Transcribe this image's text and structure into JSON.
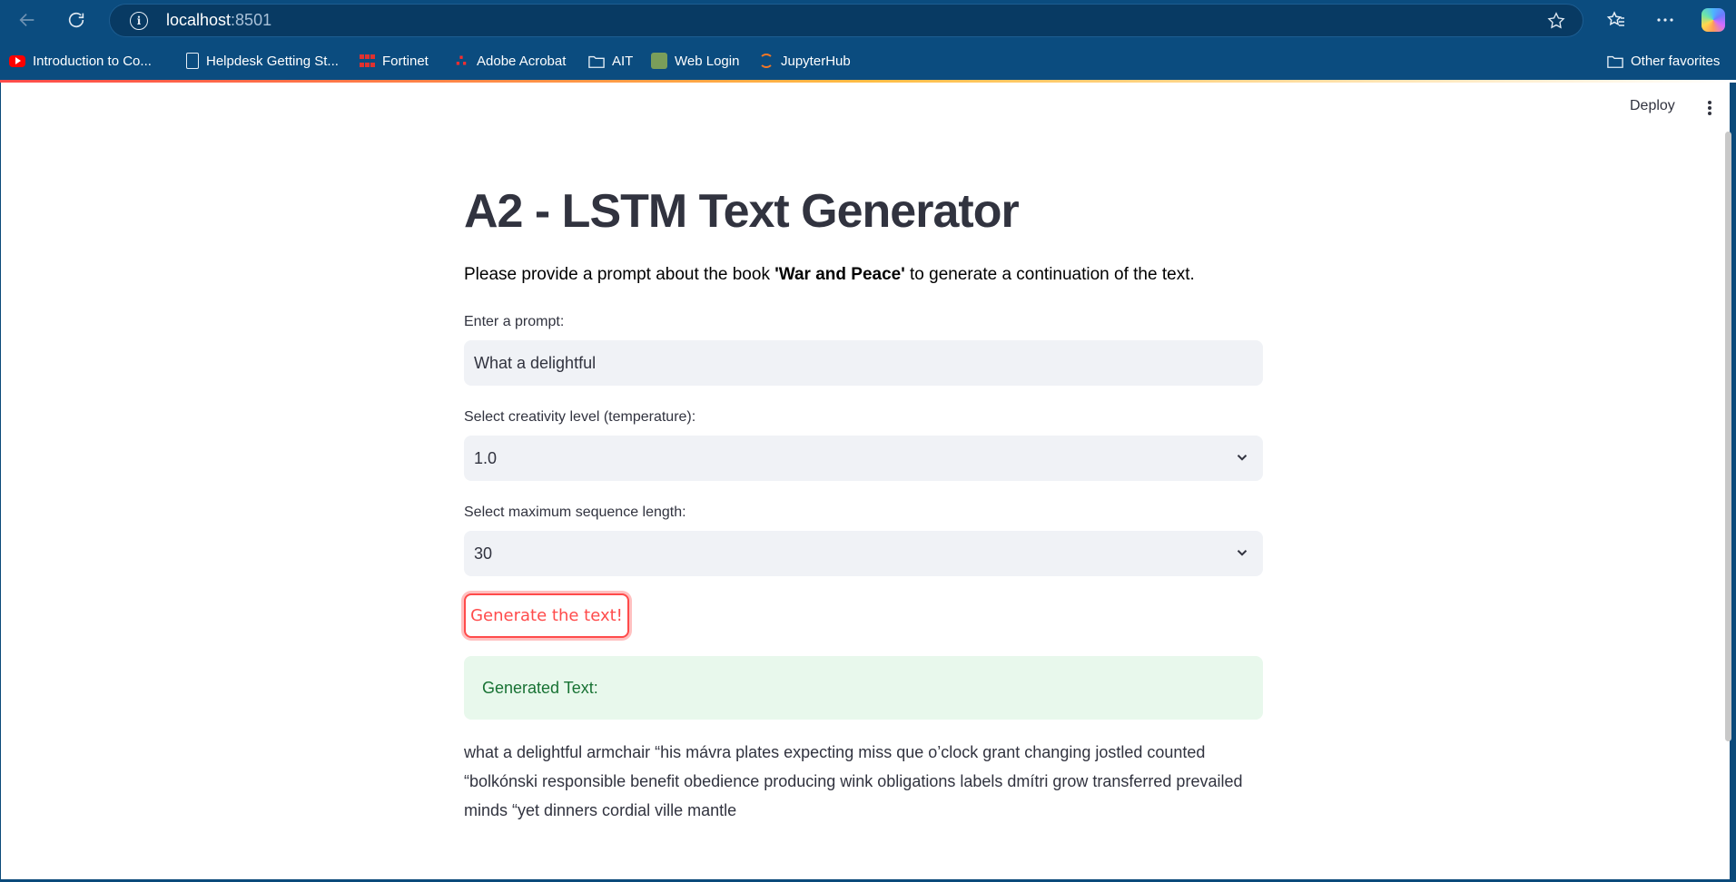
{
  "browser": {
    "url_host": "localhost",
    "url_port": ":8501",
    "bookmarks": [
      {
        "label": "Introduction to Co...",
        "icon": "youtube-icon"
      },
      {
        "label": "Helpdesk Getting St...",
        "icon": "document-icon"
      },
      {
        "label": "Fortinet",
        "icon": "fortinet-icon"
      },
      {
        "label": "Adobe Acrobat",
        "icon": "adobe-acrobat-icon"
      },
      {
        "label": "AIT",
        "icon": "folder-icon"
      },
      {
        "label": "Web Login",
        "icon": "web-login-icon"
      },
      {
        "label": "JupyterHub",
        "icon": "jupyter-icon"
      }
    ],
    "other_favorites": "Other favorites"
  },
  "app": {
    "deploy_label": "Deploy",
    "title": "A2 - LSTM Text Generator",
    "subtitle_pre": "Please provide a prompt about the book ",
    "subtitle_bold": "'War and Peace'",
    "subtitle_post": " to generate a continuation of the text.",
    "prompt_label": "Enter a prompt:",
    "prompt_value": "What a delightful",
    "temperature_label": "Select creativity level (temperature):",
    "temperature_value": "1.0",
    "seqlen_label": "Select maximum sequence length:",
    "seqlen_value": "30",
    "generate_button": "Generate the text!",
    "generated_heading": "Generated Text:",
    "generated_text": "what a delightful armchair “his mávra plates expecting miss que o’clock grant changing jostled counted “bolkónski responsible benefit obedience producing wink obligations labels dmítri grow transferred prevailed minds “yet dinners cordial ville mantle"
  },
  "colors": {
    "accent": "#ff4b4b",
    "success_bg": "#e8f8ec",
    "success_text": "#177233",
    "chrome": "#0b4c7f"
  }
}
